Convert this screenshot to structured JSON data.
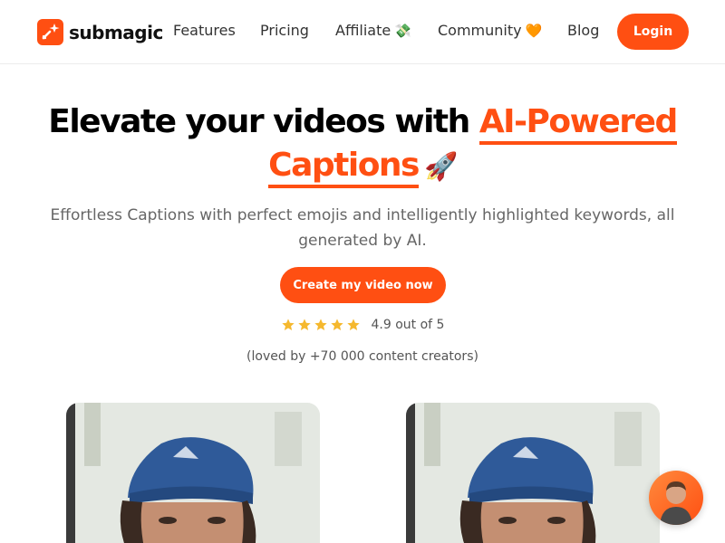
{
  "brand": {
    "name": "submagic",
    "color": "#ff4f12"
  },
  "nav": {
    "features": "Features",
    "pricing": "Pricing",
    "affiliate": "Affiliate",
    "affiliate_emoji": "💸",
    "community": "Community",
    "community_emoji": "🧡",
    "blog": "Blog",
    "login": "Login"
  },
  "hero": {
    "title_part1": "Elevate your videos with",
    "title_accent1": "AI-Powered",
    "title_accent2": "Captions",
    "title_emoji": "🚀",
    "subtitle": "Effortless Captions with perfect emojis and intelligently highlighted keywords, all generated by AI.",
    "cta": "Create my video now",
    "rating_text": "4.9 out of 5",
    "rating_value": 4.9,
    "rating_stars": 5,
    "loved_text": "(loved by +70 000 content creators)"
  },
  "icons": {
    "logo": "submagic-logo-icon",
    "star": "star-icon",
    "chat": "chat-avatar-icon"
  },
  "colors": {
    "accent": "#ff4f12",
    "star": "#f5b82e",
    "text_muted": "#666666"
  }
}
